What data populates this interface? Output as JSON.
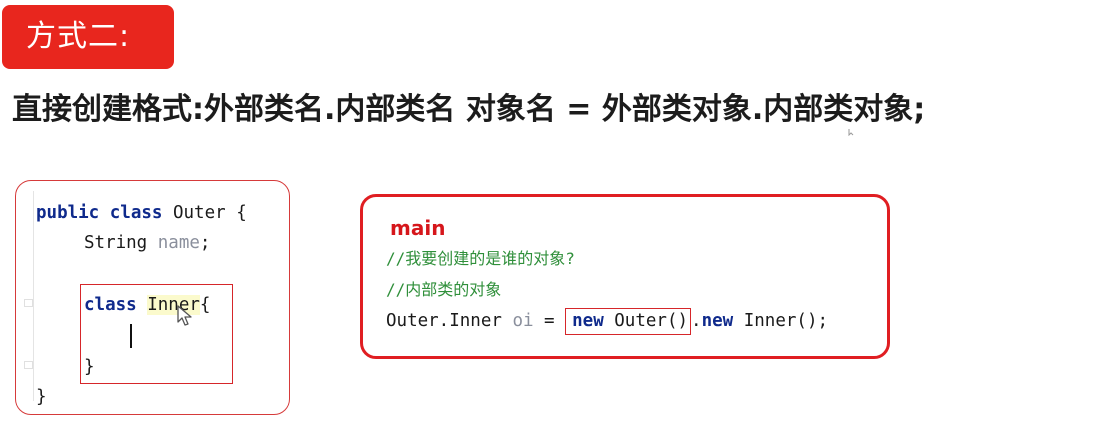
{
  "badge": {
    "label": "方式二:"
  },
  "heading": {
    "text": "直接创建格式:外部类名.内部类名 对象名 = 外部类对象.内部类对象;"
  },
  "left_code": {
    "line1_kw1": "public",
    "line1_kw2": "class",
    "line1_rest": " Outer {",
    "line2_type": "String ",
    "line2_field": "name",
    "line2_end": ";",
    "line3_kw": "class",
    "line3_space": " ",
    "line3_name": "Inner",
    "line3_end": "{",
    "line4_close": "}",
    "line5_close": "}"
  },
  "right_code": {
    "label": "main",
    "comment1": "//我要创建的是谁的对象?",
    "comment2": "//内部类的对象",
    "stmt_type": "Outer.Inner ",
    "stmt_var": "oi",
    "stmt_eq": " = ",
    "stmt_new1": "new",
    "stmt_outer": " Outer()",
    "stmt_dot": ".",
    "stmt_new2": "new",
    "stmt_inner": " Inner();"
  }
}
